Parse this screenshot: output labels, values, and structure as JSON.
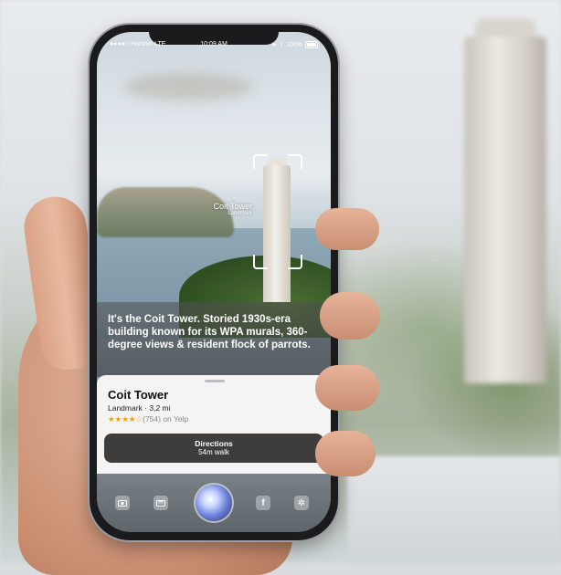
{
  "status_bar": {
    "carrier": "●●●●○ Horizon  LTE",
    "time": "10:09 AM",
    "battery": "100%"
  },
  "ar_label": {
    "name": "Coit Tower",
    "type": "Landmark"
  },
  "siri": {
    "text": "It's the Coit Tower. Storied 1930s-era building known for its WPA murals, 360-degree views & resident flock of parrots."
  },
  "card": {
    "title": "Coit Tower",
    "subtitle": "Landmark · 3,2 mi",
    "stars": "★★★★☆",
    "reviews": "(754) on Yelp",
    "directions_label": "Directions",
    "directions_sub": "54m walk"
  },
  "dock": {
    "icons": [
      "camera-icon",
      "camera-switch-icon",
      "siri-icon",
      "facebook-icon",
      "yelp-icon"
    ],
    "facebook_glyph": "f",
    "yelp_glyph": "✲"
  }
}
